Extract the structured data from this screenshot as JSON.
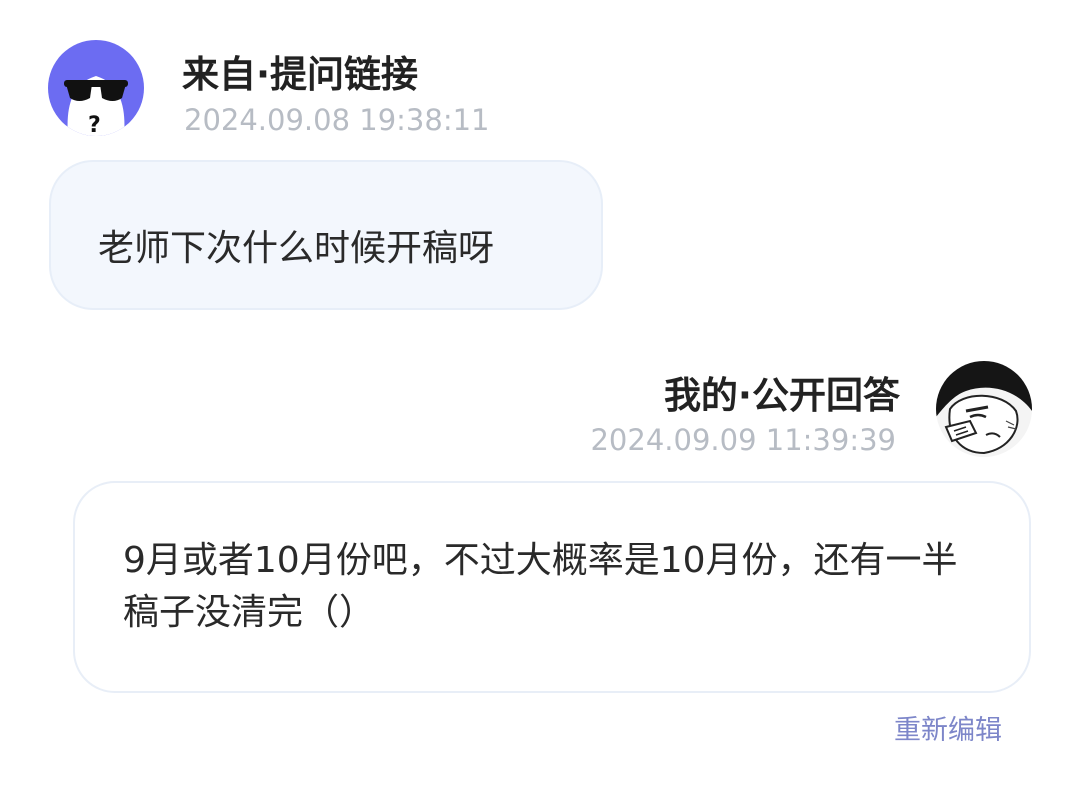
{
  "question": {
    "avatar_icon": "sunglasses-cartoon-avatar",
    "title": "来自·提问链接",
    "timestamp": "2024.09.08 19:38:11",
    "text": "老师下次什么时候开稿呀"
  },
  "answer": {
    "avatar_icon": "manga-character-avatar",
    "title": "我的·公开回答",
    "timestamp": "2024.09.09 11:39:39",
    "text": "9月或者10月份吧，不过大概率是10月份，还有一半稿子没清完（）"
  },
  "actions": {
    "edit_label": "重新编辑"
  },
  "colors": {
    "avatar_purple": "#6c6cf2",
    "question_bubble_bg": "#f3f7fd",
    "timestamp_gray": "#b7bcc4",
    "link_color": "#7d86c9"
  }
}
